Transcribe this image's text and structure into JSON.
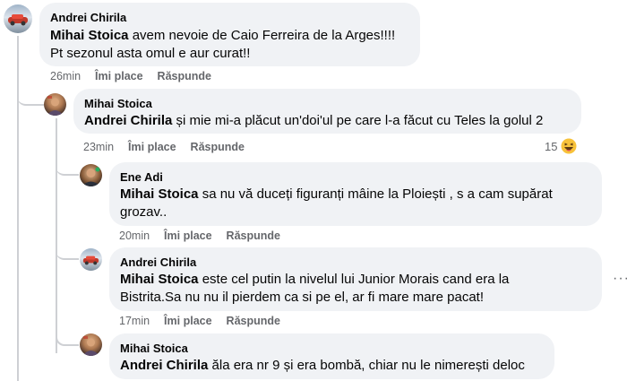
{
  "comments": [
    {
      "author": "Andrei Chirila",
      "mention": "Mihai Stoica",
      "text_line1": " avem nevoie de Caio Ferreira de la Arges!!!!",
      "text_line2": "Pt sezonul asta omul e aur curat!!",
      "time": "26min",
      "like_label": "Îmi place",
      "reply_label": "Răspunde"
    },
    {
      "author": "Mihai Stoica",
      "mention": "Andrei Chirila",
      "text_line1": " și mie mi-a plăcut un'doi'ul pe care l-a făcut cu Teles la golul 2",
      "time": "23min",
      "like_label": "Îmi place",
      "reply_label": "Răspunde",
      "reaction_count": "15",
      "reaction_icon": "laugh-emoji-icon"
    },
    {
      "author": "Ene Adi",
      "mention": "Mihai Stoica",
      "text_line1": " sa nu vă duceți figuranți mâine la Ploiești , s a cam supărat",
      "text_line2": "grozav..",
      "time": "20min",
      "like_label": "Îmi place",
      "reply_label": "Răspunde"
    },
    {
      "author": "Andrei Chirila",
      "mention": "Mihai Stoica",
      "text_line1": " este cel putin la nivelul lui Junior Morais cand era la",
      "text_line2": "Bistrita.Sa nu nu il pierdem ca si pe el, ar fi mare mare pacat!",
      "time": "17min",
      "like_label": "Îmi place",
      "reply_label": "Răspunde",
      "more_icon": "more-options-icon"
    },
    {
      "author": "Mihai Stoica",
      "mention": "Andrei Chirila",
      "text_line1": " ăla era nr 9 și era bombă, chiar nu le nimerești deloc"
    }
  ],
  "colors": {
    "bubble_bg": "#f0f2f5",
    "secondary_text": "#65676b",
    "thread_line": "#ced0d4"
  }
}
